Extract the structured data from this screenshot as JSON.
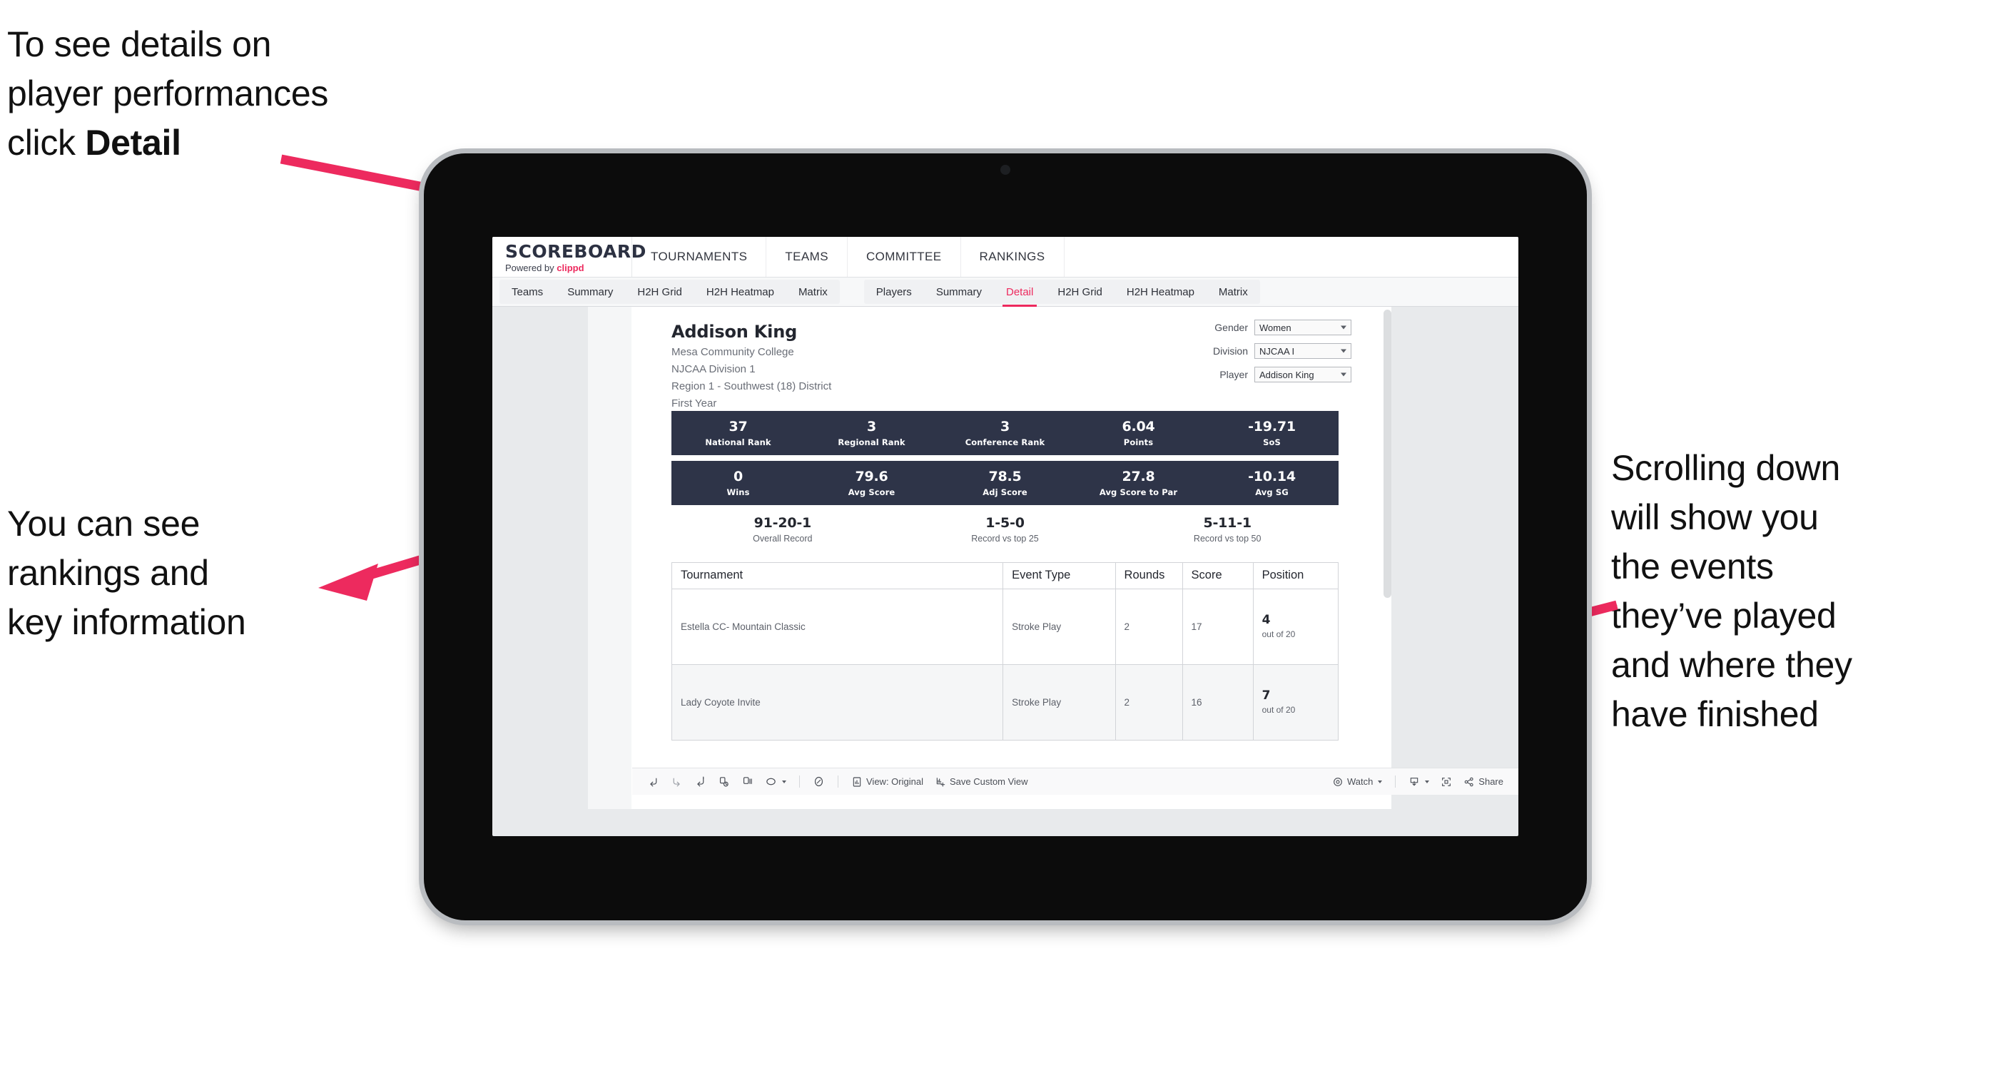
{
  "annotations": {
    "detail": "To see details on\nplayer performances\nclick ",
    "detail_bold": "Detail",
    "rankings": "You can see\nrankings and\nkey information",
    "scrolling": "Scrolling down\nwill show you\nthe events\nthey’ve played\nand where they\nhave finished"
  },
  "colors": {
    "accent_pink": "#ed2a5e",
    "navy": "#2e3448",
    "page_bg": "#e8eaec"
  },
  "app": {
    "brand": {
      "title": "SCOREBOARD",
      "powered_prefix": "Powered by ",
      "powered_brand": "clippd"
    },
    "top_nav": [
      "TOURNAMENTS",
      "TEAMS",
      "COMMITTEE",
      "RANKINGS"
    ],
    "tabs_teams": [
      "Teams",
      "Summary",
      "H2H Grid",
      "H2H Heatmap",
      "Matrix"
    ],
    "tabs_players": [
      "Players",
      "Summary",
      "Detail",
      "H2H Grid",
      "H2H Heatmap",
      "Matrix"
    ],
    "active_tab": "Detail"
  },
  "player": {
    "name": "Addison King",
    "school": "Mesa Community College",
    "division": "NJCAA Division 1",
    "region": "Region 1 - Southwest (18) District",
    "year": "First Year"
  },
  "filters": [
    {
      "label": "Gender",
      "value": "Women"
    },
    {
      "label": "Division",
      "value": "NJCAA I"
    },
    {
      "label": "Player",
      "value": "Addison King"
    }
  ],
  "stats_row1": [
    {
      "value": "37",
      "label": "National Rank"
    },
    {
      "value": "3",
      "label": "Regional Rank"
    },
    {
      "value": "3",
      "label": "Conference Rank"
    },
    {
      "value": "6.04",
      "label": "Points"
    },
    {
      "value": "-19.71",
      "label": "SoS"
    }
  ],
  "stats_row2": [
    {
      "value": "0",
      "label": "Wins"
    },
    {
      "value": "79.6",
      "label": "Avg Score"
    },
    {
      "value": "78.5",
      "label": "Adj Score"
    },
    {
      "value": "27.8",
      "label": "Avg Score to Par"
    },
    {
      "value": "-10.14",
      "label": "Avg SG"
    }
  ],
  "records": [
    {
      "value": "91-20-1",
      "label": "Overall Record"
    },
    {
      "value": "1-5-0",
      "label": "Record vs top 25"
    },
    {
      "value": "5-11-1",
      "label": "Record vs top 50"
    }
  ],
  "events_table": {
    "columns": [
      "Tournament",
      "Event Type",
      "Rounds",
      "Score",
      "Position"
    ],
    "rows": [
      {
        "tournament": "Estella CC- Mountain Classic",
        "event_type": "Stroke Play",
        "rounds": "2",
        "score": "17",
        "position": "4",
        "position_sub": "out of 20"
      },
      {
        "tournament": "Lady Coyote Invite",
        "event_type": "Stroke Play",
        "rounds": "2",
        "score": "16",
        "position": "7",
        "position_sub": "out of 20"
      }
    ]
  },
  "toolbar": {
    "view_label": "View: Original",
    "save_label": "Save Custom View",
    "watch_label": "Watch",
    "share_label": "Share"
  }
}
